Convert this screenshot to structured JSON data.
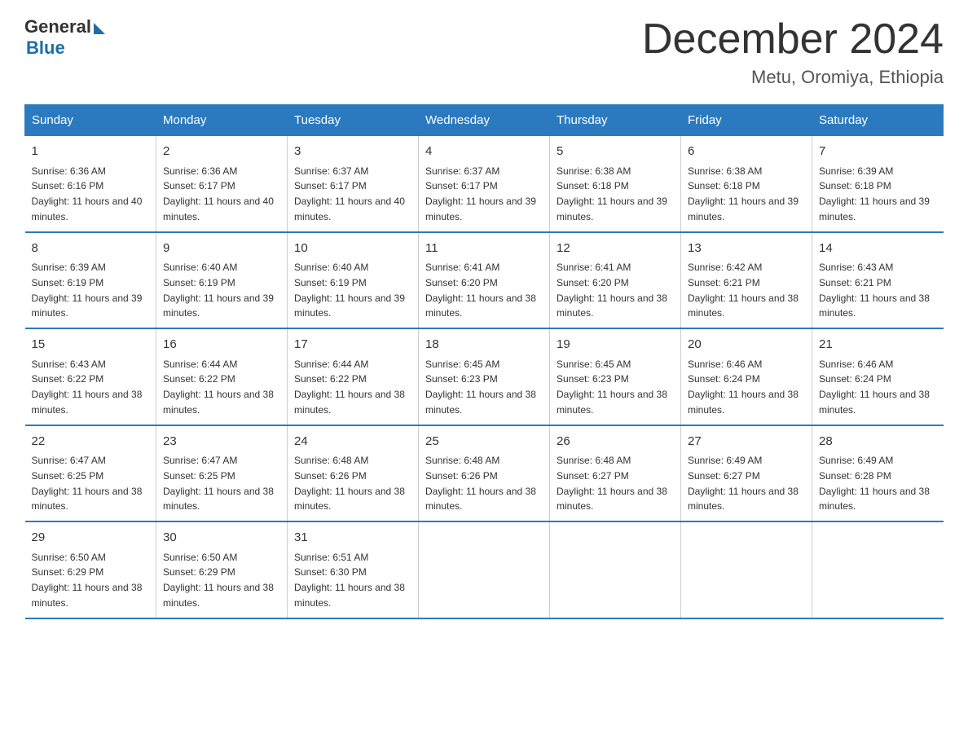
{
  "logo": {
    "general": "General",
    "blue": "Blue"
  },
  "title": "December 2024",
  "location": "Metu, Oromiya, Ethiopia",
  "days_header": [
    "Sunday",
    "Monday",
    "Tuesday",
    "Wednesday",
    "Thursday",
    "Friday",
    "Saturday"
  ],
  "weeks": [
    [
      {
        "day": "1",
        "sunrise": "6:36 AM",
        "sunset": "6:16 PM",
        "daylight": "11 hours and 40 minutes."
      },
      {
        "day": "2",
        "sunrise": "6:36 AM",
        "sunset": "6:17 PM",
        "daylight": "11 hours and 40 minutes."
      },
      {
        "day": "3",
        "sunrise": "6:37 AM",
        "sunset": "6:17 PM",
        "daylight": "11 hours and 40 minutes."
      },
      {
        "day": "4",
        "sunrise": "6:37 AM",
        "sunset": "6:17 PM",
        "daylight": "11 hours and 39 minutes."
      },
      {
        "day": "5",
        "sunrise": "6:38 AM",
        "sunset": "6:18 PM",
        "daylight": "11 hours and 39 minutes."
      },
      {
        "day": "6",
        "sunrise": "6:38 AM",
        "sunset": "6:18 PM",
        "daylight": "11 hours and 39 minutes."
      },
      {
        "day": "7",
        "sunrise": "6:39 AM",
        "sunset": "6:18 PM",
        "daylight": "11 hours and 39 minutes."
      }
    ],
    [
      {
        "day": "8",
        "sunrise": "6:39 AM",
        "sunset": "6:19 PM",
        "daylight": "11 hours and 39 minutes."
      },
      {
        "day": "9",
        "sunrise": "6:40 AM",
        "sunset": "6:19 PM",
        "daylight": "11 hours and 39 minutes."
      },
      {
        "day": "10",
        "sunrise": "6:40 AM",
        "sunset": "6:19 PM",
        "daylight": "11 hours and 39 minutes."
      },
      {
        "day": "11",
        "sunrise": "6:41 AM",
        "sunset": "6:20 PM",
        "daylight": "11 hours and 38 minutes."
      },
      {
        "day": "12",
        "sunrise": "6:41 AM",
        "sunset": "6:20 PM",
        "daylight": "11 hours and 38 minutes."
      },
      {
        "day": "13",
        "sunrise": "6:42 AM",
        "sunset": "6:21 PM",
        "daylight": "11 hours and 38 minutes."
      },
      {
        "day": "14",
        "sunrise": "6:43 AM",
        "sunset": "6:21 PM",
        "daylight": "11 hours and 38 minutes."
      }
    ],
    [
      {
        "day": "15",
        "sunrise": "6:43 AM",
        "sunset": "6:22 PM",
        "daylight": "11 hours and 38 minutes."
      },
      {
        "day": "16",
        "sunrise": "6:44 AM",
        "sunset": "6:22 PM",
        "daylight": "11 hours and 38 minutes."
      },
      {
        "day": "17",
        "sunrise": "6:44 AM",
        "sunset": "6:22 PM",
        "daylight": "11 hours and 38 minutes."
      },
      {
        "day": "18",
        "sunrise": "6:45 AM",
        "sunset": "6:23 PM",
        "daylight": "11 hours and 38 minutes."
      },
      {
        "day": "19",
        "sunrise": "6:45 AM",
        "sunset": "6:23 PM",
        "daylight": "11 hours and 38 minutes."
      },
      {
        "day": "20",
        "sunrise": "6:46 AM",
        "sunset": "6:24 PM",
        "daylight": "11 hours and 38 minutes."
      },
      {
        "day": "21",
        "sunrise": "6:46 AM",
        "sunset": "6:24 PM",
        "daylight": "11 hours and 38 minutes."
      }
    ],
    [
      {
        "day": "22",
        "sunrise": "6:47 AM",
        "sunset": "6:25 PM",
        "daylight": "11 hours and 38 minutes."
      },
      {
        "day": "23",
        "sunrise": "6:47 AM",
        "sunset": "6:25 PM",
        "daylight": "11 hours and 38 minutes."
      },
      {
        "day": "24",
        "sunrise": "6:48 AM",
        "sunset": "6:26 PM",
        "daylight": "11 hours and 38 minutes."
      },
      {
        "day": "25",
        "sunrise": "6:48 AM",
        "sunset": "6:26 PM",
        "daylight": "11 hours and 38 minutes."
      },
      {
        "day": "26",
        "sunrise": "6:48 AM",
        "sunset": "6:27 PM",
        "daylight": "11 hours and 38 minutes."
      },
      {
        "day": "27",
        "sunrise": "6:49 AM",
        "sunset": "6:27 PM",
        "daylight": "11 hours and 38 minutes."
      },
      {
        "day": "28",
        "sunrise": "6:49 AM",
        "sunset": "6:28 PM",
        "daylight": "11 hours and 38 minutes."
      }
    ],
    [
      {
        "day": "29",
        "sunrise": "6:50 AM",
        "sunset": "6:29 PM",
        "daylight": "11 hours and 38 minutes."
      },
      {
        "day": "30",
        "sunrise": "6:50 AM",
        "sunset": "6:29 PM",
        "daylight": "11 hours and 38 minutes."
      },
      {
        "day": "31",
        "sunrise": "6:51 AM",
        "sunset": "6:30 PM",
        "daylight": "11 hours and 38 minutes."
      },
      null,
      null,
      null,
      null
    ]
  ]
}
